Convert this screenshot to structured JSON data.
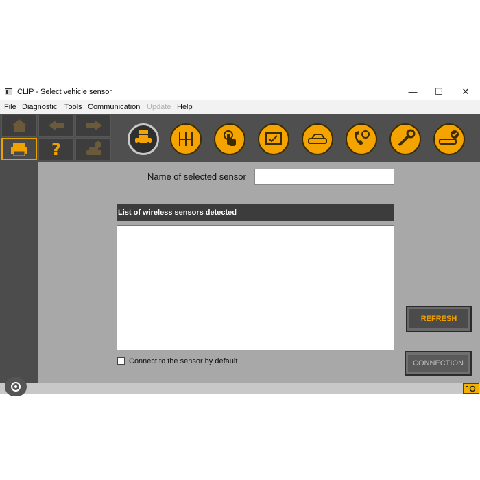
{
  "window": {
    "title": "CLIP - Select vehicle sensor",
    "minimize": "—",
    "maximize": "☐",
    "close": "✕"
  },
  "menu": {
    "items": [
      {
        "label": "File",
        "enabled": true
      },
      {
        "label": "Diagnostic",
        "enabled": true
      },
      {
        "label": "Tools",
        "enabled": true
      },
      {
        "label": "Communication",
        "enabled": true
      },
      {
        "label": "Update",
        "enabled": false
      },
      {
        "label": "Help",
        "enabled": true
      }
    ]
  },
  "nav": {
    "help_symbol": "?",
    "icons": [
      "home-icon",
      "back-arrow-icon",
      "forward-arrow-icon",
      "print-icon",
      "help-icon",
      "vehicle-alert-icon"
    ]
  },
  "toolbar": {
    "icons": [
      "vehicle-sensor-icon",
      "gearbox-icon",
      "touch-icon",
      "checklist-card-icon",
      "car-diagnostic-icon",
      "phone-support-icon",
      "wrench-icon",
      "car-check-icon"
    ],
    "active_index": 0
  },
  "form": {
    "name_label": "Name of selected sensor",
    "name_value": "",
    "list_header": "List of wireless sensors detected",
    "sensors": [],
    "default_checkbox_label": "Connect to the sensor by default",
    "default_checked": false
  },
  "buttons": {
    "refresh": "REFRESH",
    "connection": "CONNECTION"
  },
  "colors": {
    "accent": "#f5a300",
    "panel": "#4f4f4f",
    "content_bg": "#a8a8a8"
  }
}
